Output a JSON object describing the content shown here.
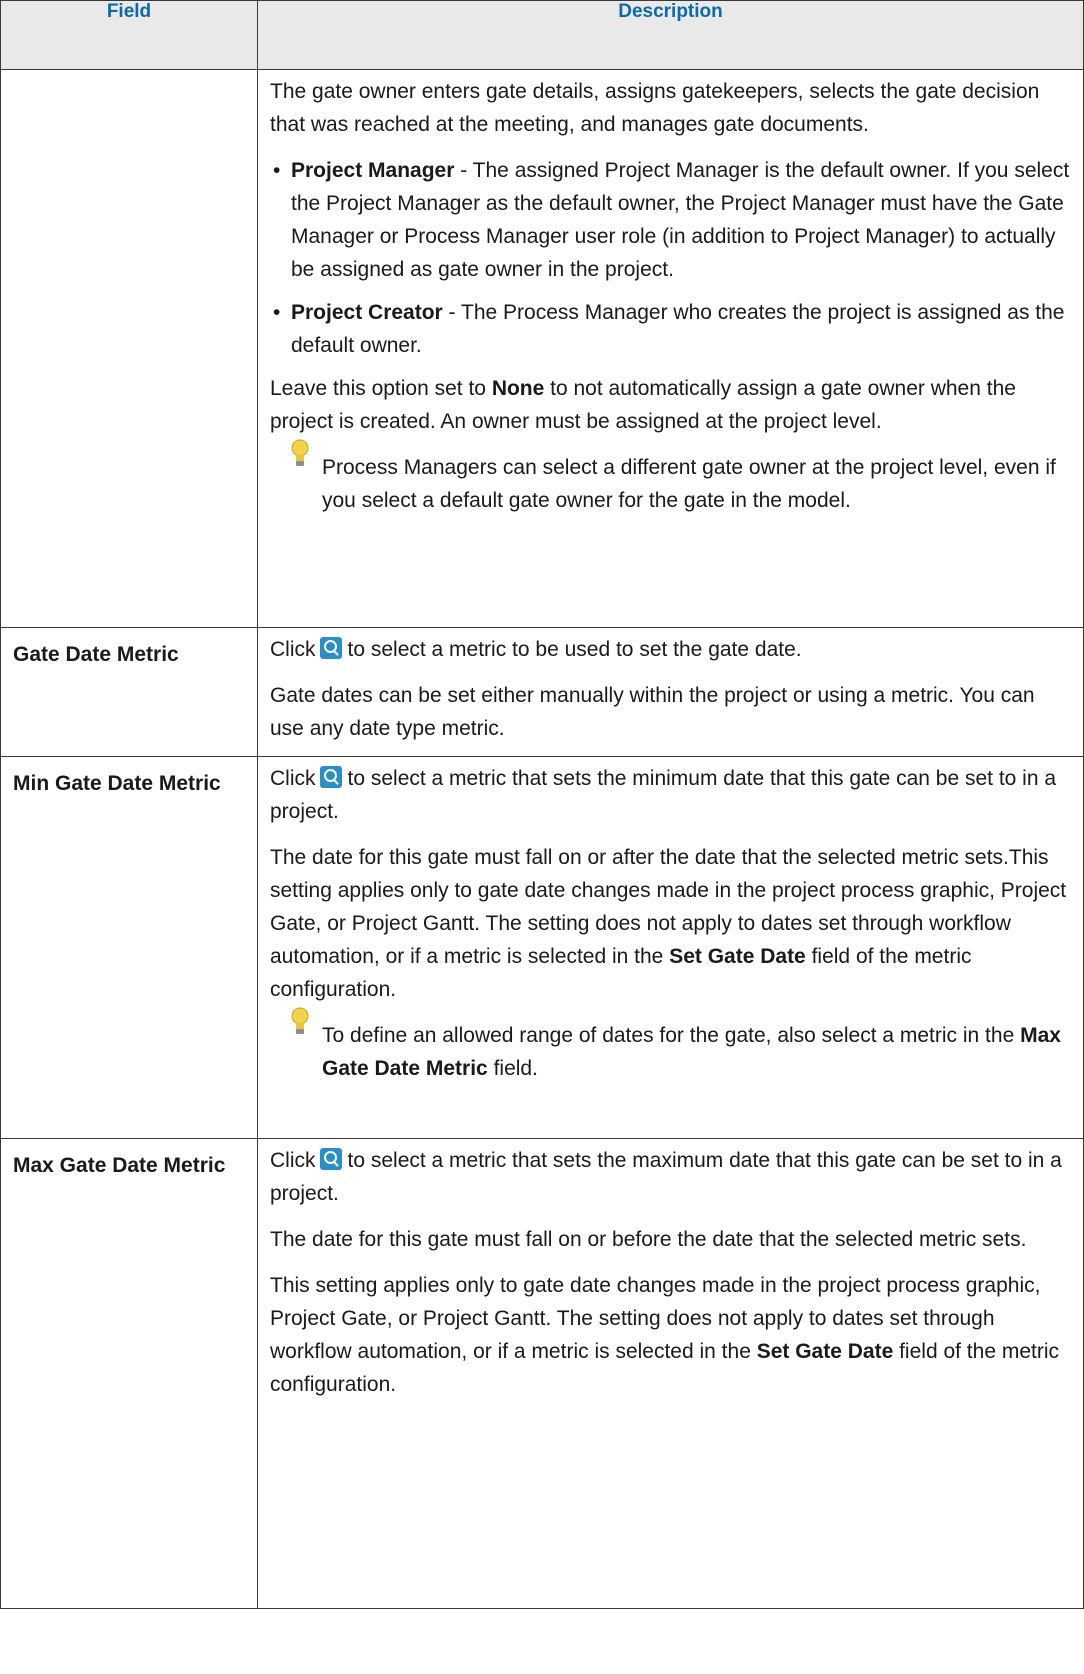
{
  "header": {
    "field": "Field",
    "description": "Description"
  },
  "row_owner": {
    "intro": "The gate owner enters gate details, assigns gatekeepers, selects the gate decision that was reached at the meeting, and manages gate documents.",
    "bullets": [
      {
        "term": "Project Manager",
        "text": " - The assigned Project Manager is the default owner. If you select the Project Manager as the default owner, the Project Manager must have the Gate Manager or Process Manager user role (in addition to Project Manager) to actually be assigned as gate owner in the project."
      },
      {
        "term": "Project Creator",
        "text": " - The Process Manager who creates the project is assigned as the default owner."
      }
    ],
    "leave_pre": "Leave this option set to ",
    "leave_bold": "None",
    "leave_post": " to not automatically assign a gate owner when the project is created. An owner must be assigned at the project level.",
    "tip": "Process Managers can select a different gate owner at the project level, even if you select a default gate owner for the gate in the model."
  },
  "row_gate_date": {
    "field": "Gate Date Metric",
    "click": "Click",
    "line1": "to select a metric to be used to set the gate date.",
    "para2": "Gate dates can be set either manually within the project or using a metric. You can use any date type metric."
  },
  "row_min": {
    "field": "Min Gate Date Metric",
    "click": "Click",
    "line1": "to select a metric that sets the minimum date that this gate can be set to in a project.",
    "para2_pre": "The date for this gate must fall on or after the date that the selected metric sets.This setting applies only to gate date changes made in the project process graphic, Project Gate, or Project Gantt. The setting does not apply to dates set through workflow automation, or if a metric is selected in the ",
    "para2_bold": "Set Gate Date",
    "para2_post": " field of the metric configuration.",
    "tip_pre": "To define an allowed range of dates for the gate, also select a metric in the ",
    "tip_bold": "Max Gate Date Metric",
    "tip_post": " field."
  },
  "row_max": {
    "field": "Max Gate Date Metric",
    "click": "Click",
    "line1": "to select a metric that sets the maximum date that this gate can be set to in a project.",
    "para2": "The date for this gate must fall on or before the date that the selected metric sets.",
    "para3_pre": "This setting applies only to gate date changes made in the project process graphic, Project Gate, or Project Gantt. The setting does not apply to dates set through workflow automation, or if a metric is selected in the ",
    "para3_bold": "Set Gate Date",
    "para3_post": " field of the metric configuration."
  }
}
